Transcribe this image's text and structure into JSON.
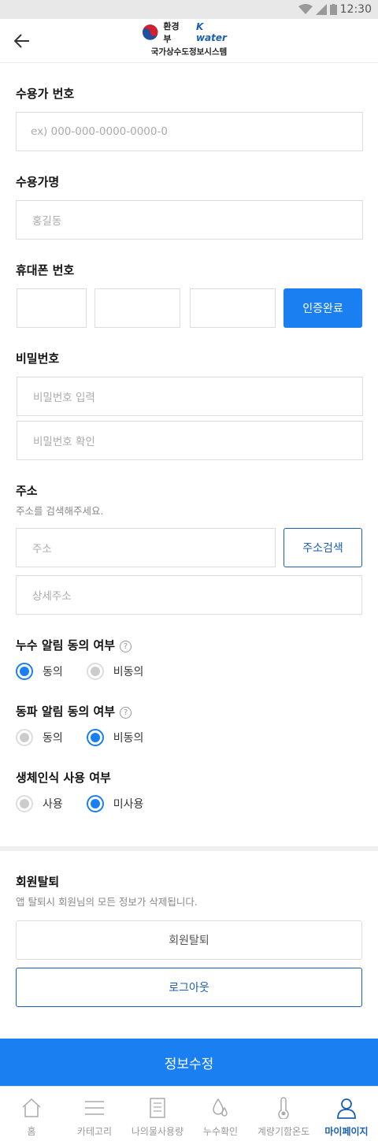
{
  "status_bar": {
    "time": "12:30"
  },
  "header": {
    "ministry": "환경부",
    "kwater": "K water",
    "system_name": "국가상수도정보시스템"
  },
  "form": {
    "customer_number": {
      "label": "수용가 번호",
      "placeholder": "ex) 000-000-0000-0000-0"
    },
    "customer_name": {
      "label": "수용가명",
      "placeholder": "홍길동"
    },
    "phone": {
      "label": "휴대폰 번호",
      "verify_button": "인증완료"
    },
    "password": {
      "label": "비밀번호",
      "placeholder": "비밀번호 입력",
      "confirm_placeholder": "비밀번호 확인"
    },
    "address": {
      "label": "주소",
      "hint": "주소를 검색해주세요.",
      "placeholder": "주소",
      "search_button": "주소검색",
      "detail_placeholder": "상세주소"
    },
    "leak_alert": {
      "label": "누수 알림 동의 여부",
      "help": "?",
      "options": [
        "동의",
        "비동의"
      ],
      "selected": "동의"
    },
    "freeze_alert": {
      "label": "동파 알림 동의 여부",
      "help": "?",
      "options": [
        "동의",
        "비동의"
      ],
      "selected": "비동의"
    },
    "biometric": {
      "label": "생체인식 사용 여부",
      "options": [
        "사용",
        "미사용"
      ],
      "selected": "미사용"
    }
  },
  "withdraw": {
    "title": "회원탈퇴",
    "notice": "앱 탈퇴시 회원님의 모든 정보가 삭제됩니다.",
    "withdraw_button": "회원탈퇴",
    "logout_button": "로그아웃"
  },
  "submit_button": "정보수정",
  "tabs": [
    {
      "label": "홈",
      "icon": "home-icon"
    },
    {
      "label": "카테고리",
      "icon": "menu-icon"
    },
    {
      "label": "나의물사용량",
      "icon": "document-icon"
    },
    {
      "label": "누수확인",
      "icon": "water-drop-icon"
    },
    {
      "label": "계량기함온도",
      "icon": "thermometer-icon"
    },
    {
      "label": "마이페이지",
      "icon": "user-icon"
    }
  ],
  "active_tab": "마이페이지",
  "colors": {
    "primary": "#1a7ff0",
    "outline_blue": "#1a5fb4"
  }
}
